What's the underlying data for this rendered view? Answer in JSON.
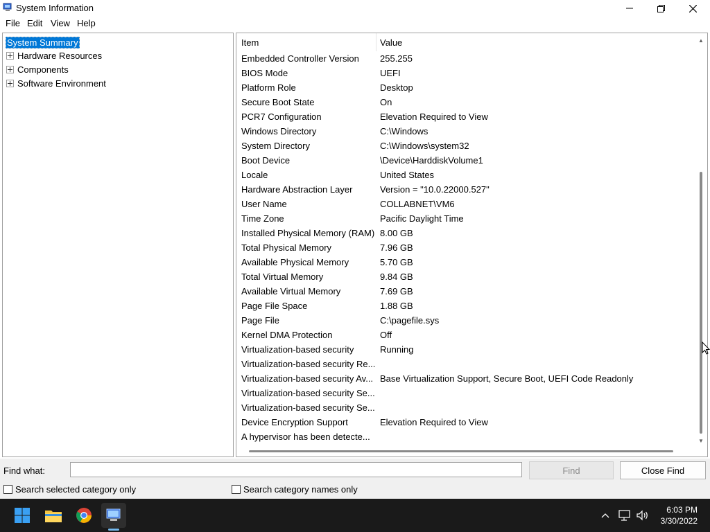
{
  "window": {
    "title": "System Information"
  },
  "menu": {
    "items": [
      {
        "label": "File"
      },
      {
        "label": "Edit"
      },
      {
        "label": "View"
      },
      {
        "label": "Help"
      }
    ]
  },
  "tree": {
    "root": "System Summary",
    "children": [
      {
        "label": "Hardware Resources"
      },
      {
        "label": "Components"
      },
      {
        "label": "Software Environment"
      }
    ]
  },
  "table": {
    "columns": [
      "Item",
      "Value"
    ],
    "rows": [
      {
        "item": "Embedded Controller Version",
        "value": "255.255"
      },
      {
        "item": "BIOS Mode",
        "value": "UEFI"
      },
      {
        "item": "Platform Role",
        "value": "Desktop"
      },
      {
        "item": "Secure Boot State",
        "value": "On"
      },
      {
        "item": "PCR7 Configuration",
        "value": "Elevation Required to View"
      },
      {
        "item": "Windows Directory",
        "value": "C:\\Windows"
      },
      {
        "item": "System Directory",
        "value": "C:\\Windows\\system32"
      },
      {
        "item": "Boot Device",
        "value": "\\Device\\HarddiskVolume1"
      },
      {
        "item": "Locale",
        "value": "United States"
      },
      {
        "item": "Hardware Abstraction Layer",
        "value": "Version = \"10.0.22000.527\""
      },
      {
        "item": "User Name",
        "value": "COLLABNET\\VM6"
      },
      {
        "item": "Time Zone",
        "value": "Pacific Daylight Time"
      },
      {
        "item": "Installed Physical Memory (RAM)",
        "value": "8.00 GB"
      },
      {
        "item": "Total Physical Memory",
        "value": "7.96 GB"
      },
      {
        "item": "Available Physical Memory",
        "value": "5.70 GB"
      },
      {
        "item": "Total Virtual Memory",
        "value": "9.84 GB"
      },
      {
        "item": "Available Virtual Memory",
        "value": "7.69 GB"
      },
      {
        "item": "Page File Space",
        "value": "1.88 GB"
      },
      {
        "item": "Page File",
        "value": "C:\\pagefile.sys"
      },
      {
        "item": "Kernel DMA Protection",
        "value": "Off"
      },
      {
        "item": "Virtualization-based security",
        "value": "Running"
      },
      {
        "item": "Virtualization-based security Re...",
        "value": ""
      },
      {
        "item": "Virtualization-based security Av...",
        "value": "Base Virtualization Support, Secure Boot, UEFI Code Readonly"
      },
      {
        "item": "Virtualization-based security Se...",
        "value": ""
      },
      {
        "item": "Virtualization-based security Se...",
        "value": ""
      },
      {
        "item": "Device Encryption Support",
        "value": "Elevation Required to View"
      },
      {
        "item": "A hypervisor has been detecte...",
        "value": ""
      }
    ]
  },
  "find": {
    "label": "Find what:",
    "value": "",
    "find_button": "Find",
    "close_button": "Close Find",
    "search_selected": "Search selected category only",
    "search_names": "Search category names only"
  },
  "taskbar": {
    "apps": [
      {
        "icon": "windows-start-icon"
      },
      {
        "icon": "file-explorer-icon"
      },
      {
        "icon": "chrome-icon"
      },
      {
        "icon": "system-information-icon"
      }
    ],
    "time": "6:03 PM",
    "date": "3/30/2022"
  },
  "colors": {
    "selection": "#0078d7",
    "taskbar": "#1a1a1a"
  }
}
